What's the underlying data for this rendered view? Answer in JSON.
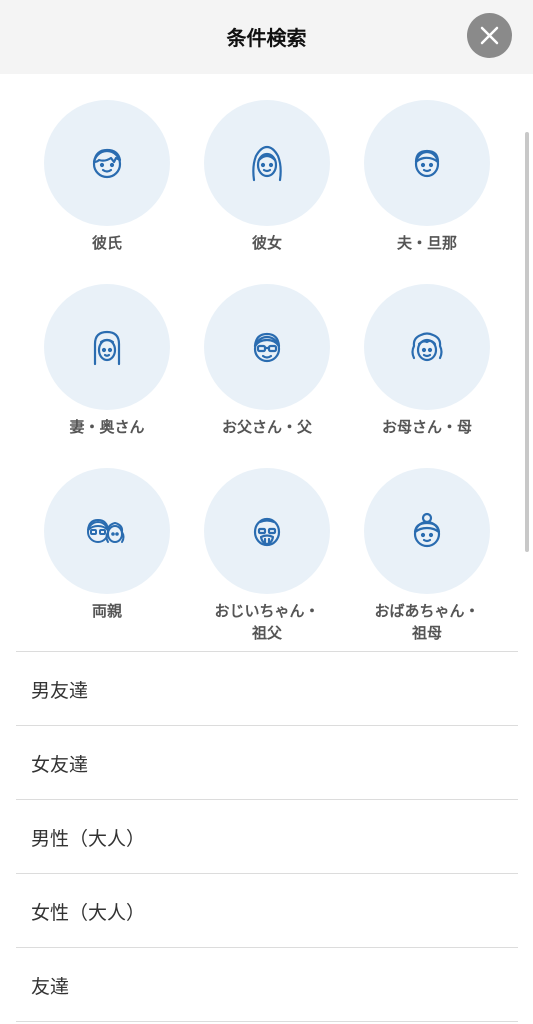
{
  "header": {
    "title": "条件検索",
    "close_icon": "close-icon"
  },
  "grid": [
    {
      "label": "彼氏",
      "icon": "boyfriend-icon"
    },
    {
      "label": "彼女",
      "icon": "girlfriend-icon"
    },
    {
      "label": "夫・旦那",
      "icon": "husband-icon"
    },
    {
      "label": "妻・奥さん",
      "icon": "wife-icon"
    },
    {
      "label": "お父さん・父",
      "icon": "father-icon"
    },
    {
      "label": "お母さん・母",
      "icon": "mother-icon"
    },
    {
      "label": "両親",
      "icon": "parents-icon"
    },
    {
      "label": "おじいちゃん・\n祖父",
      "icon": "grandfather-icon"
    },
    {
      "label": "おばあちゃん・\n祖母",
      "icon": "grandmother-icon"
    }
  ],
  "list": [
    {
      "label": "男友達"
    },
    {
      "label": "女友達"
    },
    {
      "label": "男性（大人）"
    },
    {
      "label": "女性（大人）"
    },
    {
      "label": "友達"
    }
  ],
  "colors": {
    "icon_stroke": "#2a6cb0",
    "circle_bg": "#e9f1f8",
    "close_bg": "#8a8a8a"
  }
}
